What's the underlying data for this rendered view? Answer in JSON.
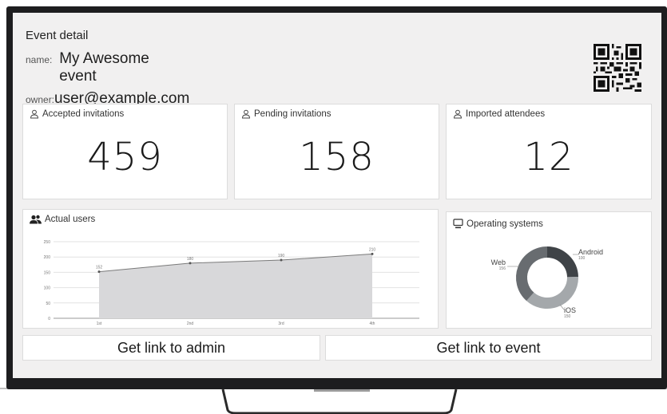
{
  "event": {
    "section_title": "Event detail",
    "name_label": "name:",
    "name_value": "My Awesome event",
    "owner_label": "owner:",
    "owner_value": "user@example.com"
  },
  "stats": [
    {
      "label": "Accepted invitations",
      "value": "459",
      "icon": "user-outline-icon"
    },
    {
      "label": "Pending invitations",
      "value": "158",
      "icon": "user-outline-icon"
    },
    {
      "label": "Imported attendees",
      "value": "12",
      "icon": "user-outline-icon"
    }
  ],
  "users_chart": {
    "title": "Actual users",
    "icon": "users-group-icon"
  },
  "os_chart": {
    "title": "Operating systems",
    "icon": "desktop-icon"
  },
  "buttons": {
    "admin_label": "Get link to admin",
    "event_label": "Get link to event"
  },
  "chart_data": [
    {
      "type": "area",
      "title": "Actual users",
      "x": [
        "1st",
        "2nd",
        "3rd",
        "4th"
      ],
      "values": [
        152,
        180,
        190,
        210
      ],
      "data_labels": [
        "152",
        "180",
        "190",
        "210"
      ],
      "yticks": [
        "0",
        "50",
        "100",
        "150",
        "200",
        "250"
      ],
      "ylim": [
        0,
        250
      ],
      "grid": true,
      "colors": {
        "fill": "#d8d8da",
        "line": "#7a7a7a"
      }
    },
    {
      "type": "pie",
      "title": "Operating systems",
      "donut": true,
      "slices": [
        {
          "name": "Android",
          "value": 100,
          "color": "#3f4347"
        },
        {
          "name": "iOS",
          "value": 150,
          "color": "#a4a8ab"
        },
        {
          "name": "Web",
          "value": 156,
          "color": "#686c70"
        }
      ]
    }
  ]
}
